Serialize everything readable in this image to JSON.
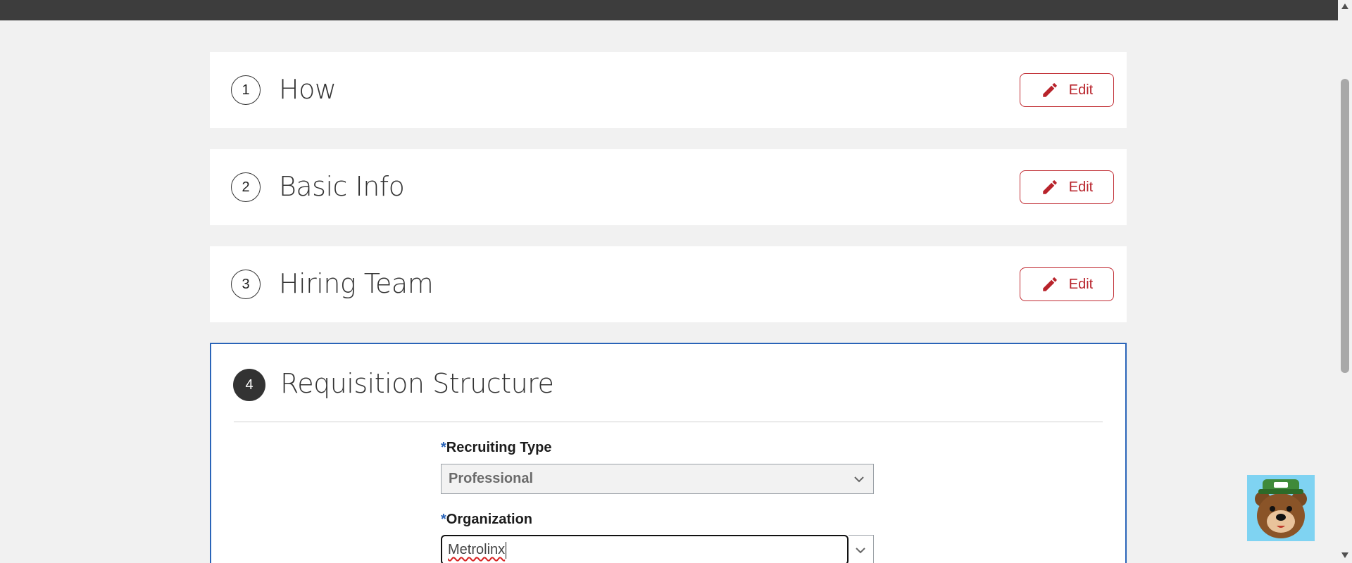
{
  "steps": [
    {
      "number": "1",
      "title": "How",
      "edit_label": "Edit"
    },
    {
      "number": "2",
      "title": "Basic Info",
      "edit_label": "Edit"
    },
    {
      "number": "3",
      "title": "Hiring Team",
      "edit_label": "Edit"
    }
  ],
  "active_step": {
    "number": "4",
    "title": "Requisition Structure",
    "fields": {
      "recruiting_type": {
        "required_mark": "*",
        "label": "Recruiting Type",
        "value": "Professional"
      },
      "organization": {
        "required_mark": "*",
        "label": "Organization",
        "value": "Metrolinx"
      }
    }
  },
  "icons": {
    "edit": "pencil-icon",
    "dropdown": "chevron-down-icon",
    "mascot": "bear-mascot-icon"
  },
  "colors": {
    "accent_red": "#c02b32",
    "active_border": "#2a64b8",
    "topbar": "#3d3d3d",
    "background": "#f1f1f1"
  }
}
